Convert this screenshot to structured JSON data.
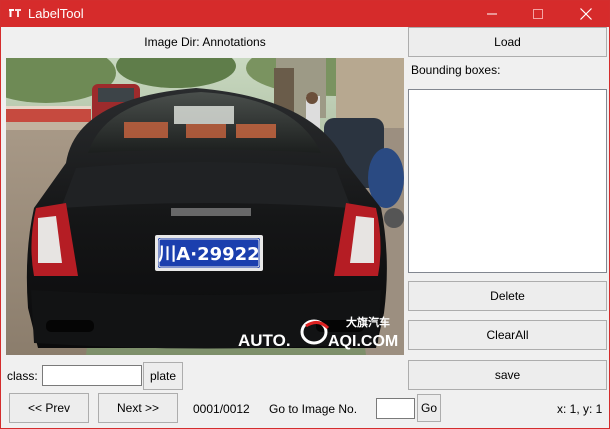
{
  "window": {
    "title": "LabelTool",
    "accent_color": "#d62b2b"
  },
  "header": {
    "image_dir_label": "Image Dir: Annotations"
  },
  "buttons": {
    "load": "Load",
    "delete": "Delete",
    "clear_all": "ClearAll",
    "save": "save",
    "plate": "plate",
    "prev": "<< Prev",
    "next": "Next >>",
    "go": "Go"
  },
  "bounding_boxes": {
    "label": "Bounding boxes:",
    "items": []
  },
  "class_field": {
    "label": "class:",
    "value": ""
  },
  "navigation": {
    "progress": "0001/0012",
    "goto_label": "Go to Image No.",
    "goto_value": ""
  },
  "status": {
    "coords": "x: 1, y: 1"
  },
  "image": {
    "license_plate": "川A·29922",
    "watermark_left": "AUTO.",
    "watermark_right": "AQI.COM",
    "watermark_brand": "大旗汽车",
    "background_icons": {
      "app_icon": "app-icon",
      "minimize": "minimize-icon",
      "maximize": "maximize-icon",
      "close": "close-icon"
    }
  }
}
